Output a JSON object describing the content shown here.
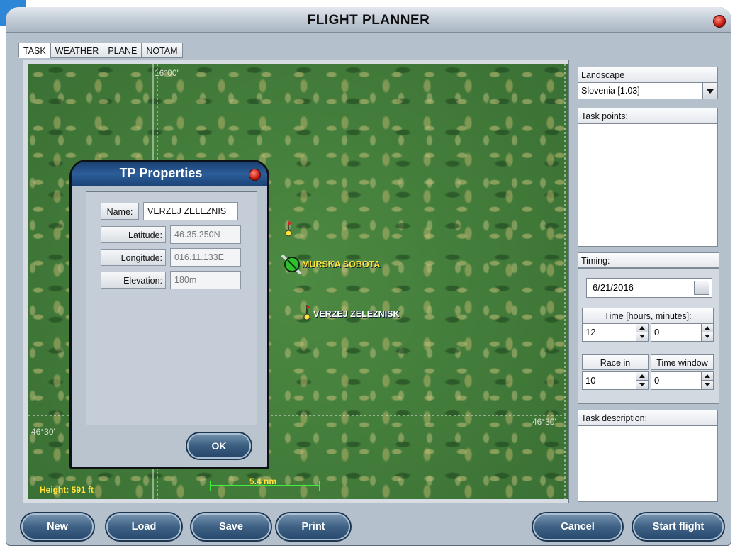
{
  "window": {
    "title": "FLIGHT PLANNER"
  },
  "tabs": [
    {
      "label": "TASK"
    },
    {
      "label": "WEATHER"
    },
    {
      "label": "PLANE"
    },
    {
      "label": "NOTAM"
    }
  ],
  "map": {
    "coord_top": "16°00'",
    "coord_left": "46°30'",
    "coord_right": "46°30'",
    "height_label": "Height: 591 ft",
    "scale_label": "5.4 nm",
    "airport_label": "MURSKA SOBOTA",
    "waypoint_label": "VERZEJ ZELEZNISK"
  },
  "tp_dialog": {
    "title": "TP Properties",
    "name_label": "Name:",
    "name_value": "VERZEJ ZELEZNIS",
    "latitude_label": "Latitude:",
    "latitude_value": "46.35.250N",
    "longitude_label": "Longitude:",
    "longitude_value": "016.11.133E",
    "elevation_label": "Elevation:",
    "elevation_value": "180m",
    "ok_label": "OK"
  },
  "right_panel": {
    "landscape_label": "Landscape",
    "landscape_value": "Slovenia [1.03]",
    "task_points_label": "Task points:",
    "timing_label": "Timing:",
    "date_value": "6/21/2016",
    "time_label": "Time [hours, minutes]:",
    "hours_value": "12",
    "minutes_value": "0",
    "race_in_label": "Race in",
    "race_in_value": "10",
    "time_window_label": "Time window",
    "time_window_value": "0",
    "task_description_label": "Task description:"
  },
  "buttons": {
    "new": "New",
    "load": "Load",
    "save": "Save",
    "print": "Print",
    "cancel": "Cancel",
    "start_flight": "Start flight"
  },
  "colors": {
    "map_label": "#ffe23a",
    "scale_bar": "#3ff03f",
    "button_blue": "#3e6184",
    "close_red": "#c0170f"
  }
}
